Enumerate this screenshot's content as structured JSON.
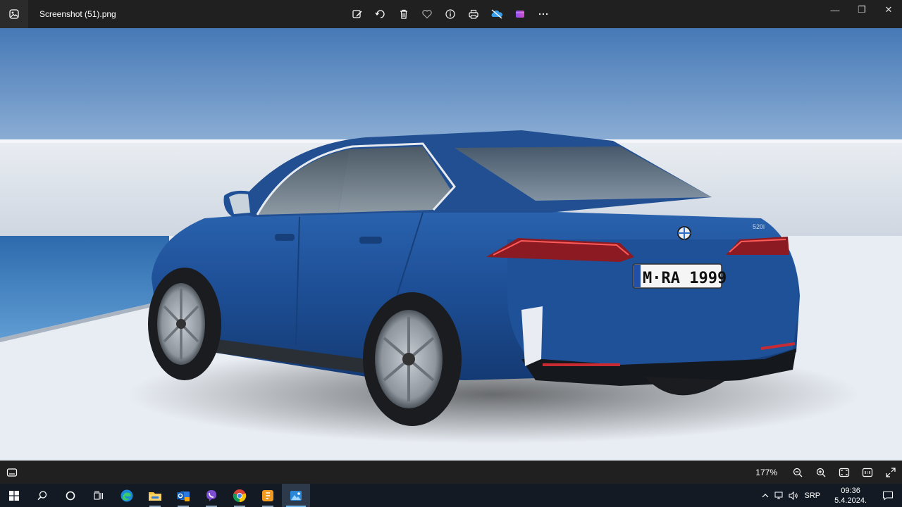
{
  "window": {
    "file_name": "Screenshot (51).png",
    "icons": [
      "photos-app-icon"
    ]
  },
  "toolbar": {
    "buttons": [
      "edit-icon",
      "rotate-icon",
      "delete-icon",
      "favorite-icon",
      "info-icon",
      "print-icon",
      "onedrive-icon",
      "clipchamp-icon",
      "more-icon"
    ]
  },
  "window_controls": {
    "minimize": "—",
    "maximize": "❐",
    "close": "✕"
  },
  "image": {
    "plate_text": "M·RA 1999",
    "model_badge": "520i",
    "colors": {
      "sky": "#4a7db7",
      "car_body": "#1e4f96",
      "wall": "#d9dee6",
      "sea": "#2f6fb3",
      "ground": "#e9eef4"
    }
  },
  "statusbar": {
    "zoom": "177%",
    "icons": [
      "filmstrip-icon",
      "zoom-out-icon",
      "zoom-in-icon",
      "fit-screen-icon",
      "actual-size-icon",
      "fullscreen-icon"
    ]
  },
  "taskbar": {
    "apps": [
      "start",
      "search",
      "cortana",
      "task-view",
      "edge",
      "file-explorer",
      "outlook",
      "viber",
      "chrome",
      "app-orange",
      "photos"
    ]
  },
  "tray": {
    "lang": "SRP",
    "time": "09:36",
    "date": "5.4.2024."
  }
}
